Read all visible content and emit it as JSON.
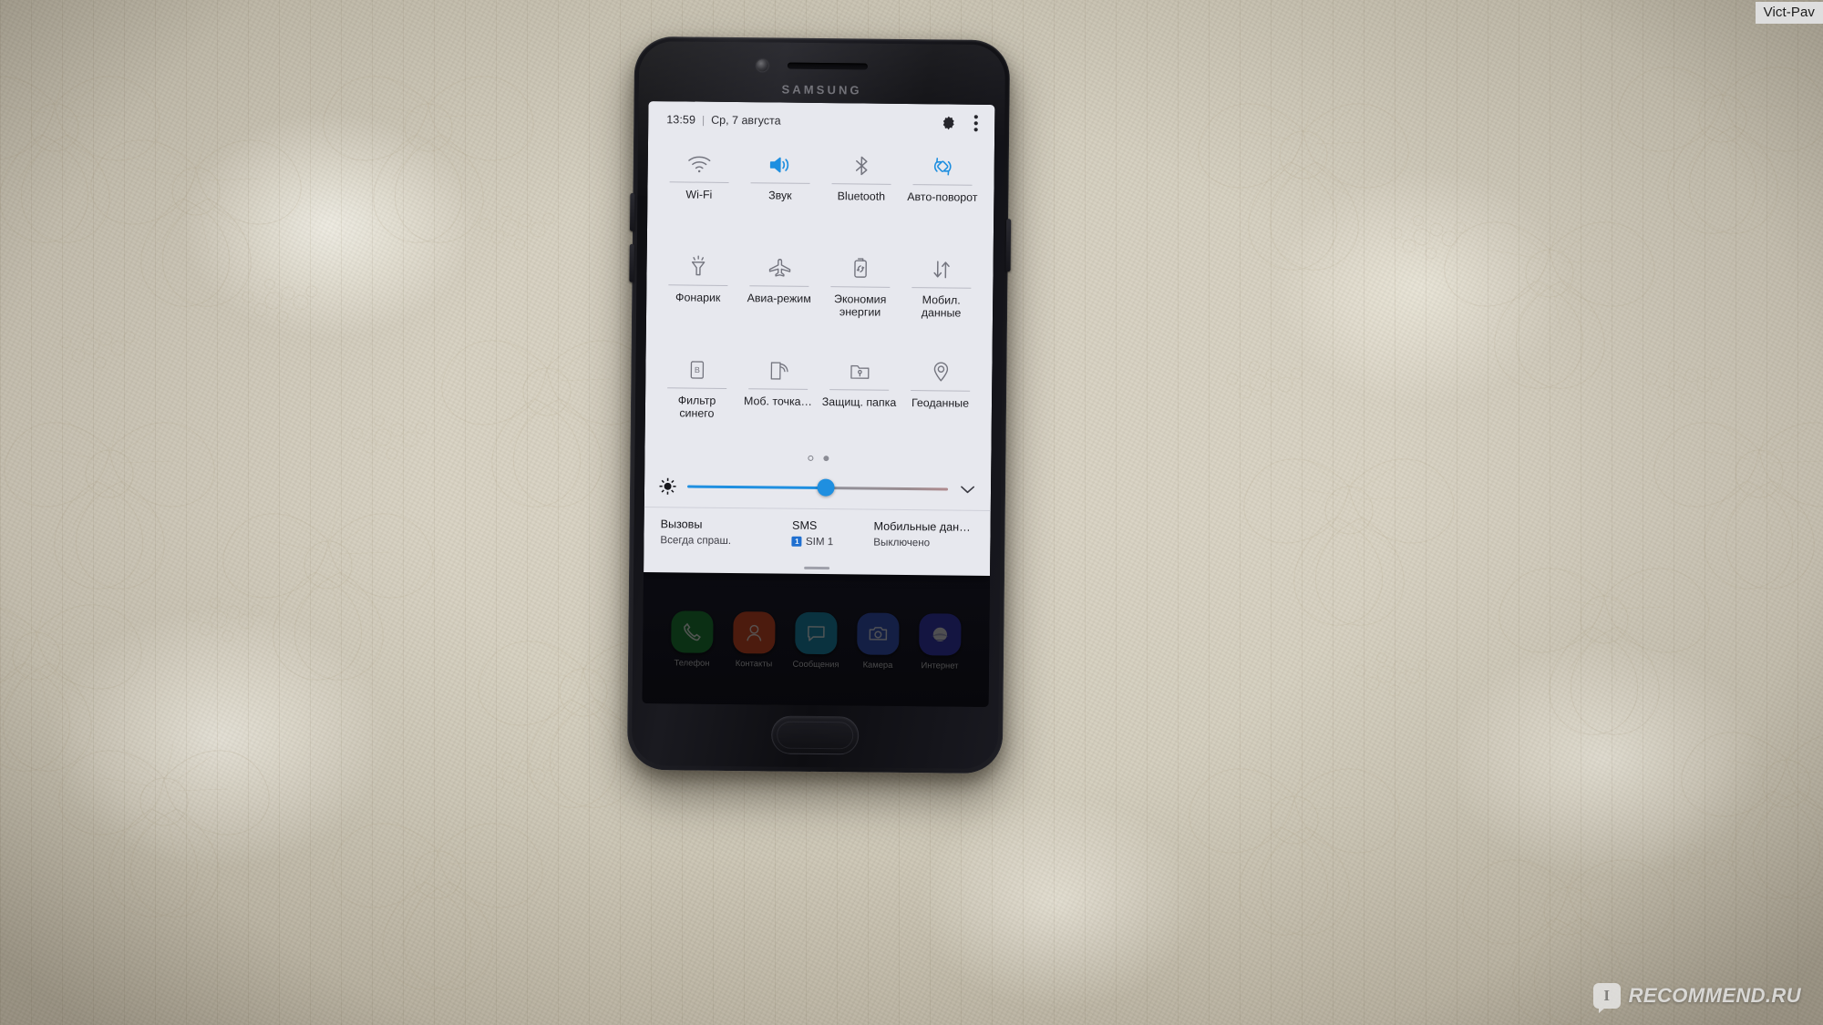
{
  "watermarks": {
    "top_right": "Vict-Pav",
    "bottom_right_logo": "I",
    "bottom_right_text": "RECOMMEND.RU"
  },
  "phone": {
    "brand": "SAMSUNG"
  },
  "quick_settings": {
    "time": "13:59",
    "separator": "|",
    "date": "Ср, 7 августа",
    "settings_icon": "gear-icon",
    "more_icon": "more-vertical-icon",
    "toggles": [
      {
        "label": "Wi-Fi",
        "icon": "wifi-icon",
        "active": false
      },
      {
        "label": "Звук",
        "icon": "sound-icon",
        "active": true
      },
      {
        "label": "Bluetooth",
        "icon": "bluetooth-icon",
        "active": false
      },
      {
        "label": "Авто-поворот",
        "icon": "auto-rotate-icon",
        "active": true
      },
      {
        "label": "Фонарик",
        "icon": "flashlight-icon",
        "active": false
      },
      {
        "label": "Авиа-режим",
        "icon": "airplane-icon",
        "active": false
      },
      {
        "label": "Экономия энергии",
        "icon": "power-saving-icon",
        "active": false
      },
      {
        "label": "Мобил. данные",
        "icon": "mobile-data-icon",
        "active": false
      },
      {
        "label": "Фильтр синего",
        "icon": "blue-light-filter-icon",
        "active": false
      },
      {
        "label": "Моб. точка…",
        "icon": "mobile-hotspot-icon",
        "active": false
      },
      {
        "label": "Защищ. папка",
        "icon": "secure-folder-icon",
        "active": false
      },
      {
        "label": "Геоданные",
        "icon": "location-icon",
        "active": false
      }
    ],
    "pages": {
      "count": 2,
      "current": 2
    },
    "brightness": {
      "icon": "brightness-icon",
      "percent": 53,
      "expand_icon": "chevron-down-icon"
    },
    "sim_info": [
      {
        "title": "Вызовы",
        "value": "Всегда спраш.",
        "badge": ""
      },
      {
        "title": "SMS",
        "value": "SIM 1",
        "badge": "1"
      },
      {
        "title": "Мобильные дан…",
        "value": "Выключено",
        "badge": ""
      }
    ]
  },
  "dock": {
    "apps": [
      {
        "label": "Телефон",
        "icon": "phone-icon",
        "color": "#1f8a3c"
      },
      {
        "label": "Контакты",
        "icon": "contacts-icon",
        "color": "#e0502a"
      },
      {
        "label": "Сообщения",
        "icon": "messages-icon",
        "color": "#1e93b8"
      },
      {
        "label": "Камера",
        "icon": "camera-icon",
        "color": "#3b5bc8"
      },
      {
        "label": "Интернет",
        "icon": "internet-icon",
        "color": "#3c3fc0"
      }
    ]
  },
  "colors": {
    "accent_blue": "#1f8fe0",
    "panel_bg": "#e7e8ee",
    "icon_inactive": "#74757f"
  }
}
